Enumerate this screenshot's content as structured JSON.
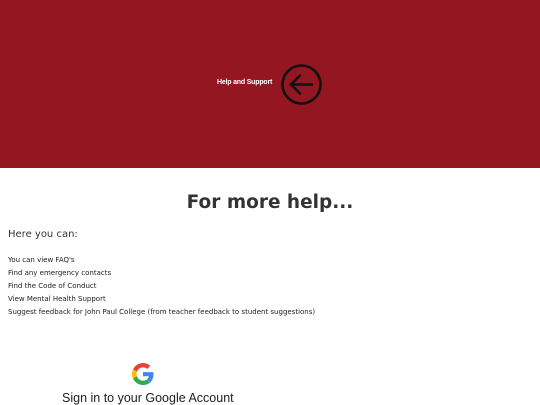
{
  "hero": {
    "title": "Help and Support",
    "back_icon": "arrow-left-circle-icon",
    "background_color": "#941620"
  },
  "main": {
    "heading": "For more help...",
    "intro": "Here you can:",
    "items": [
      "You can view FAQ's",
      "Find any emergency contacts",
      "Find the Code of Conduct",
      "View Mental Health Support",
      "Suggest feedback for John Paul College (from teacher feedback to student suggestions)"
    ]
  },
  "google": {
    "logo_icon": "google-g-icon",
    "signin_label": "Sign in to your Google Account"
  }
}
